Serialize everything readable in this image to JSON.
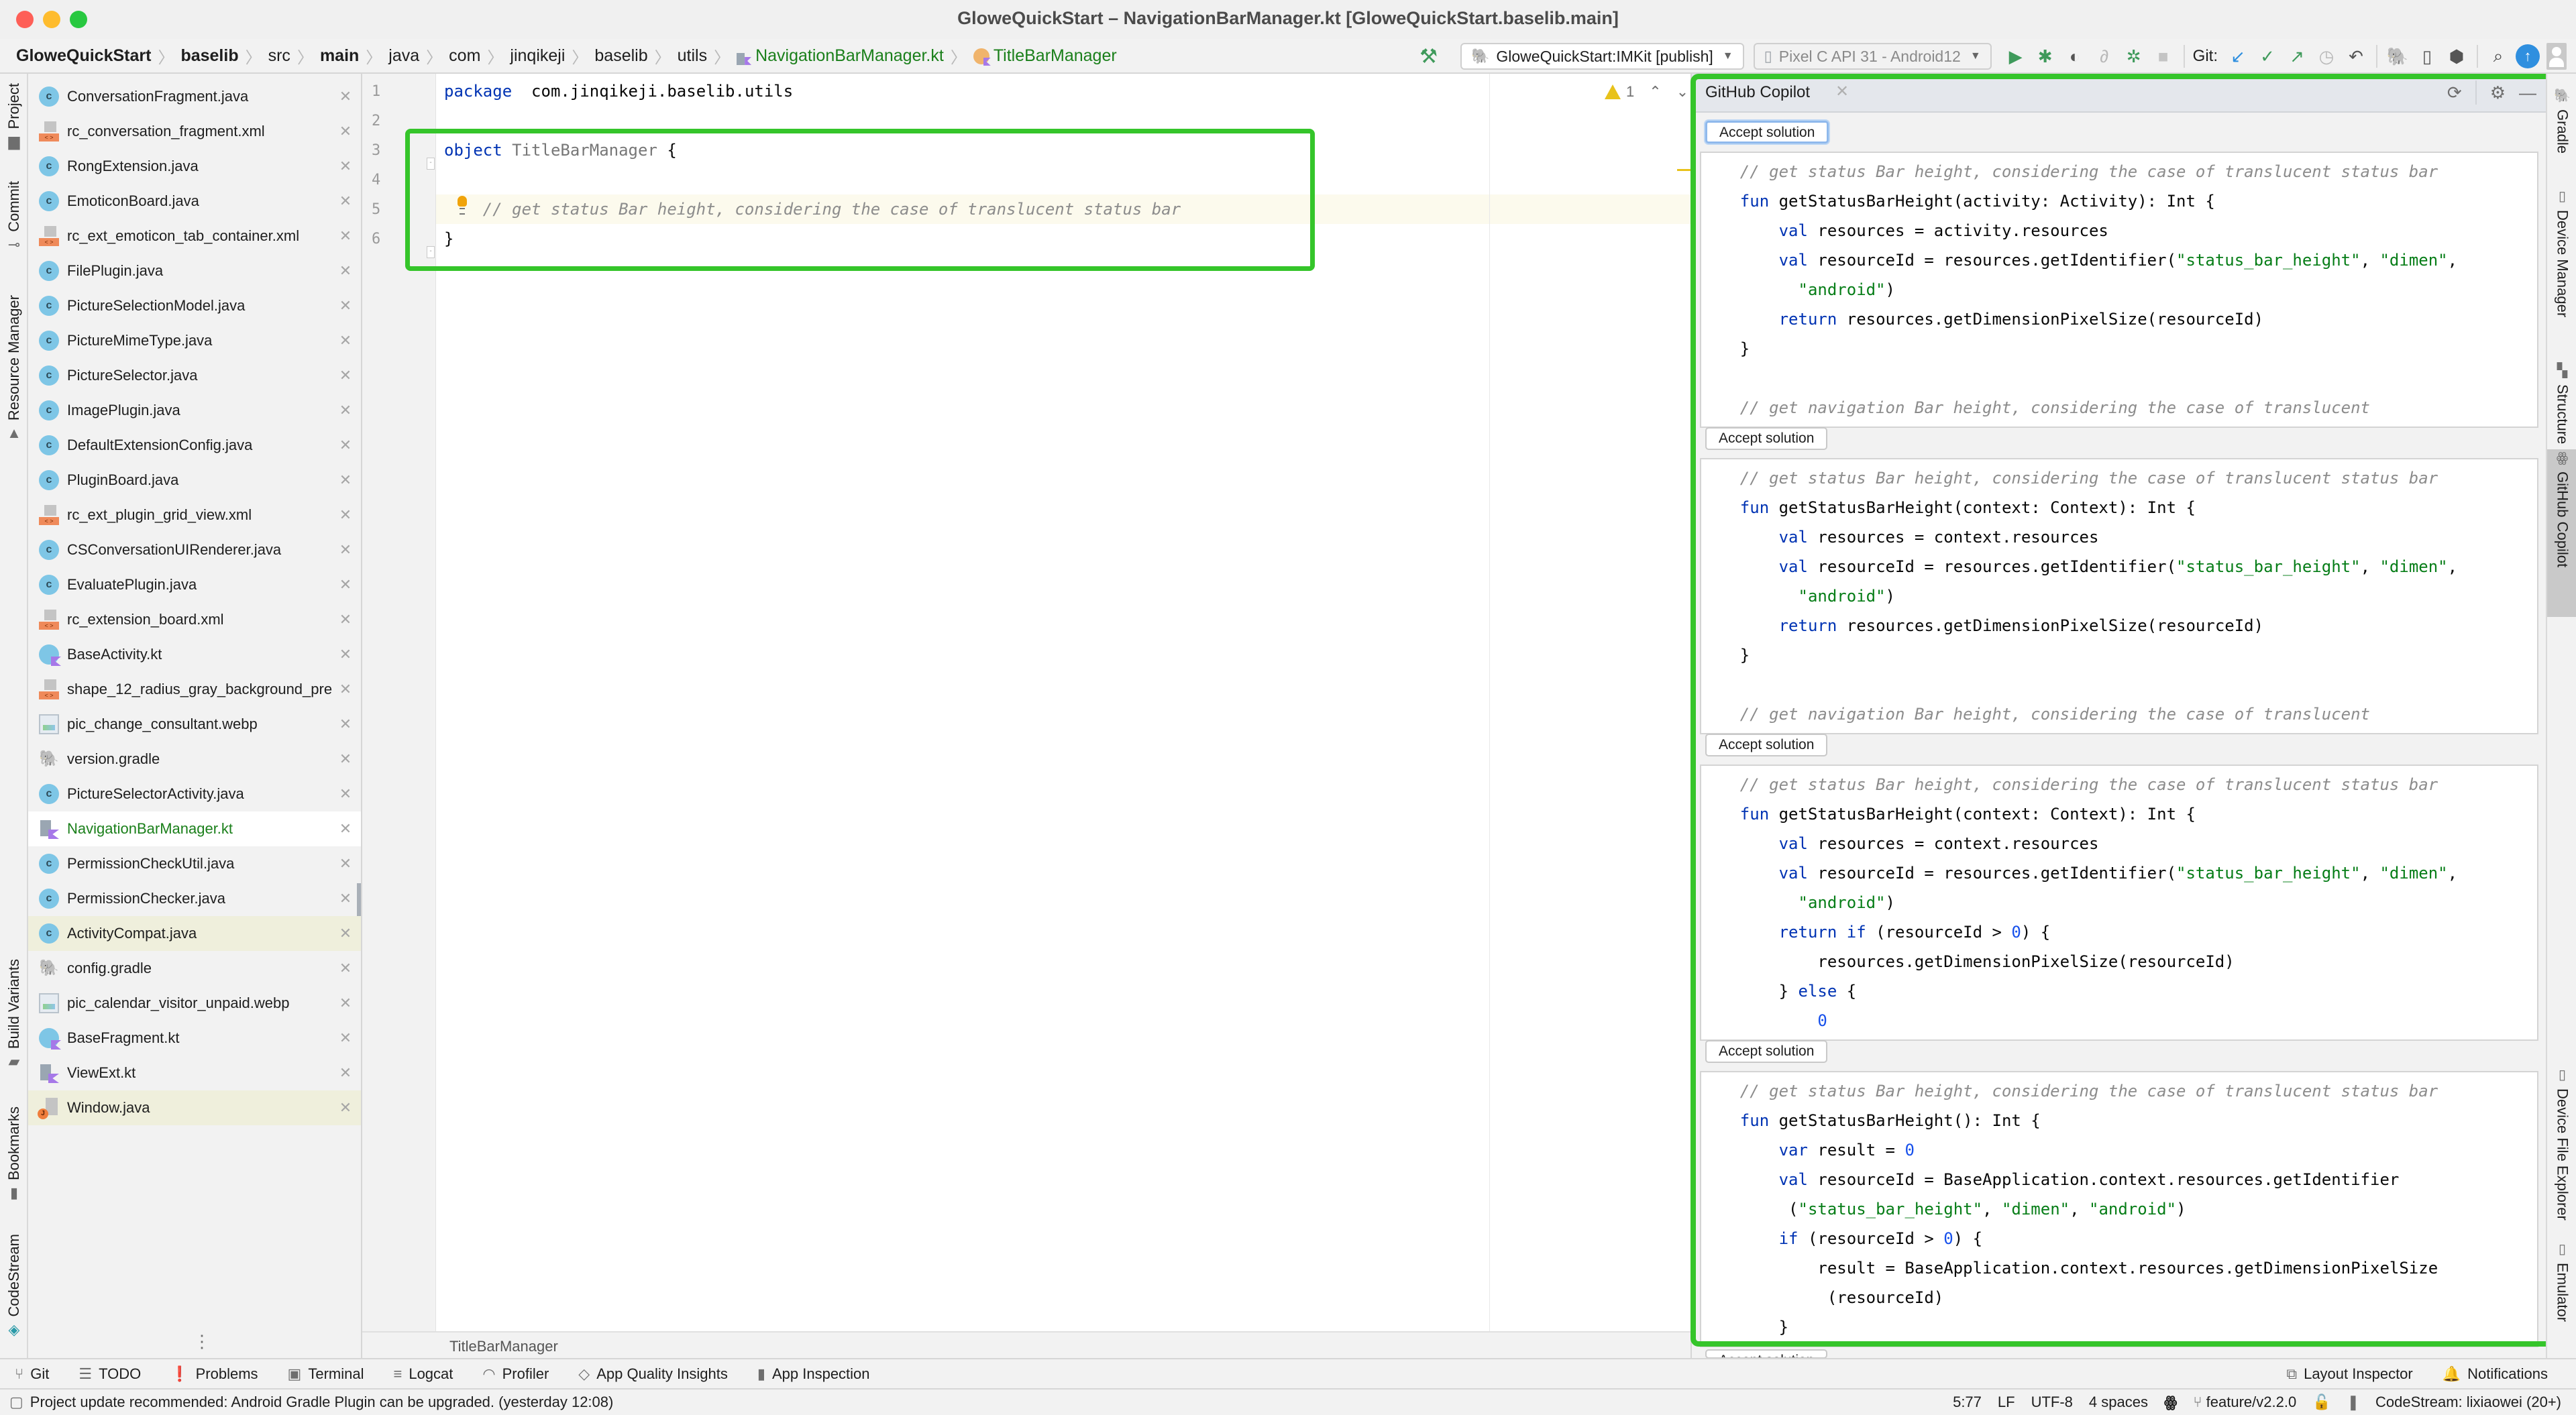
{
  "window": {
    "title": "GloweQuickStart – NavigationBarManager.kt [GloweQuickStart.baselib.main]"
  },
  "breadcrumb": [
    {
      "label": "GloweQuickStart",
      "bold": true
    },
    {
      "label": "baselib",
      "bold": true
    },
    {
      "label": "src",
      "bold": false
    },
    {
      "label": "main",
      "bold": true
    },
    {
      "label": "java",
      "bold": false
    },
    {
      "label": "com",
      "bold": false
    },
    {
      "label": "jinqikeji",
      "bold": false
    },
    {
      "label": "baselib",
      "bold": false
    },
    {
      "label": "utils",
      "bold": false
    },
    {
      "label": "NavigationBarManager.kt",
      "icon": "kotlin-file-icon"
    },
    {
      "label": "TitleBarManager",
      "icon": "kotlin-object-icon"
    }
  ],
  "toolbar": {
    "run_config": "GloweQuickStart:IMKit [publish]",
    "device": "Pixel C API 31 - Android12",
    "git_label": "Git:",
    "icons": [
      "build-hammer-icon",
      "run-icon",
      "debug-icon",
      "apply-changes-icon",
      "profile-icon",
      "attach-debugger-icon",
      "stop-icon",
      "git-update-icon",
      "git-commit-icon",
      "git-push-icon",
      "git-history-icon",
      "git-rollback-icon",
      "gradle-sync-icon",
      "device-manager-icon",
      "sdk-manager-icon",
      "search-icon",
      "update-icon",
      "avatar-icon"
    ]
  },
  "left_strip": {
    "top": [
      {
        "label": "Project",
        "icon": "folder-icon"
      },
      {
        "label": "Commit",
        "icon": "commit-icon"
      },
      {
        "label": "Resource Manager",
        "icon": "resource-manager-icon"
      }
    ],
    "bottom": [
      {
        "label": "Build Variants",
        "icon": "android-icon"
      },
      {
        "label": "Bookmarks",
        "icon": "bookmark-icon"
      },
      {
        "label": "CodeStream",
        "icon": "codestream-icon"
      }
    ]
  },
  "open_files": [
    {
      "name": "ConversationFragment.java",
      "type": "class",
      "state": ""
    },
    {
      "name": "rc_conversation_fragment.xml",
      "type": "xml",
      "state": ""
    },
    {
      "name": "RongExtension.java",
      "type": "class",
      "state": ""
    },
    {
      "name": "EmoticonBoard.java",
      "type": "class",
      "state": ""
    },
    {
      "name": "rc_ext_emoticon_tab_container.xml",
      "type": "xml",
      "state": ""
    },
    {
      "name": "FilePlugin.java",
      "type": "class",
      "state": ""
    },
    {
      "name": "PictureSelectionModel.java",
      "type": "class",
      "state": ""
    },
    {
      "name": "PictureMimeType.java",
      "type": "class",
      "state": ""
    },
    {
      "name": "PictureSelector.java",
      "type": "class",
      "state": ""
    },
    {
      "name": "ImagePlugin.java",
      "type": "class",
      "state": ""
    },
    {
      "name": "DefaultExtensionConfig.java",
      "type": "class",
      "state": ""
    },
    {
      "name": "PluginBoard.java",
      "type": "class",
      "state": ""
    },
    {
      "name": "rc_ext_plugin_grid_view.xml",
      "type": "xml",
      "state": ""
    },
    {
      "name": "CSConversationUIRenderer.java",
      "type": "class",
      "state": ""
    },
    {
      "name": "EvaluatePlugin.java",
      "type": "class",
      "state": ""
    },
    {
      "name": "rc_extension_board.xml",
      "type": "xml",
      "state": ""
    },
    {
      "name": "BaseActivity.kt",
      "type": "ktclass",
      "state": ""
    },
    {
      "name": "shape_12_radius_gray_background_pre",
      "type": "xml",
      "state": ""
    },
    {
      "name": "pic_change_consultant.webp",
      "type": "img",
      "state": ""
    },
    {
      "name": "version.gradle",
      "type": "gradle",
      "state": ""
    },
    {
      "name": "PictureSelectorActivity.java",
      "type": "class",
      "state": ""
    },
    {
      "name": "NavigationBarManager.kt",
      "type": "kt",
      "state": "active"
    },
    {
      "name": "PermissionCheckUtil.java",
      "type": "class",
      "state": ""
    },
    {
      "name": "PermissionChecker.java",
      "type": "class",
      "state": ""
    },
    {
      "name": "ActivityCompat.java",
      "type": "class",
      "state": "modified"
    },
    {
      "name": "config.gradle",
      "type": "gradle",
      "state": ""
    },
    {
      "name": "pic_calendar_visitor_unpaid.webp",
      "type": "img",
      "state": ""
    },
    {
      "name": "BaseFragment.kt",
      "type": "ktclass",
      "state": ""
    },
    {
      "name": "ViewExt.kt",
      "type": "kt",
      "state": ""
    },
    {
      "name": "Window.java",
      "type": "java",
      "state": "modified"
    }
  ],
  "editor": {
    "lines": [
      {
        "no": "1",
        "tokens": [
          [
            "kw",
            "package"
          ],
          [
            "",
            "  com.jinqikeji.baselib.utils"
          ]
        ]
      },
      {
        "no": "2",
        "tokens": []
      },
      {
        "no": "3",
        "tokens": [
          [
            "kw",
            "object"
          ],
          [
            "",
            " "
          ],
          [
            "ident-gray",
            "TitleBarManager"
          ],
          [
            "",
            " {"
          ]
        ]
      },
      {
        "no": "4",
        "tokens": []
      },
      {
        "no": "5",
        "tokens": [
          [
            "",
            " "
          ],
          [
            "cmt",
            "   // get status Bar height, considering the case of translucent status bar"
          ]
        ]
      },
      {
        "no": "6",
        "tokens": [
          [
            "",
            "}"
          ]
        ]
      }
    ],
    "current_line": 5,
    "warning_count": "1",
    "footer_breadcrumb": "TitleBarManager"
  },
  "copilot": {
    "title": "GitHub Copilot",
    "accept_label": "Accept solution",
    "solutions": [
      {
        "lines": [
          [
            [
              "cmt",
              "    // get status Bar height, considering the case of translucent status bar"
            ]
          ],
          [
            [
              "",
              "    "
            ],
            [
              "kw",
              "fun"
            ],
            [
              "",
              " getStatusBarHeight(activity: Activity): Int {"
            ]
          ],
          [
            [
              "",
              "        "
            ],
            [
              "kw",
              "val"
            ],
            [
              "",
              " resources = activity.resources"
            ]
          ],
          [
            [
              "",
              "        "
            ],
            [
              "kw",
              "val"
            ],
            [
              "",
              " resourceId = resources.getIdentifier("
            ],
            [
              "str",
              "\"status_bar_height\""
            ],
            [
              "",
              ", "
            ],
            [
              "str",
              "\"dimen\""
            ],
            [
              "",
              ","
            ]
          ],
          [
            [
              "",
              "          "
            ],
            [
              "str",
              "\"android\""
            ],
            [
              "",
              ")"
            ]
          ],
          [
            [
              "",
              "        "
            ],
            [
              "kw",
              "return"
            ],
            [
              "",
              " resources.getDimensionPixelSize(resourceId)"
            ]
          ],
          [
            [
              "",
              "    }"
            ]
          ],
          [],
          [
            [
              "cmt",
              "    // get navigation Bar height, considering the case of translucent"
            ]
          ]
        ]
      },
      {
        "lines": [
          [
            [
              "cmt",
              "    // get status Bar height, considering the case of translucent status bar"
            ]
          ],
          [
            [
              "",
              "    "
            ],
            [
              "kw",
              "fun"
            ],
            [
              "",
              " getStatusBarHeight(context: Context): Int {"
            ]
          ],
          [
            [
              "",
              "        "
            ],
            [
              "kw",
              "val"
            ],
            [
              "",
              " resources = context.resources"
            ]
          ],
          [
            [
              "",
              "        "
            ],
            [
              "kw",
              "val"
            ],
            [
              "",
              " resourceId = resources.getIdentifier("
            ],
            [
              "str",
              "\"status_bar_height\""
            ],
            [
              "",
              ", "
            ],
            [
              "str",
              "\"dimen\""
            ],
            [
              "",
              ","
            ]
          ],
          [
            [
              "",
              "          "
            ],
            [
              "str",
              "\"android\""
            ],
            [
              "",
              ")"
            ]
          ],
          [
            [
              "",
              "        "
            ],
            [
              "kw",
              "return"
            ],
            [
              "",
              " resources.getDimensionPixelSize(resourceId)"
            ]
          ],
          [
            [
              "",
              "    }"
            ]
          ],
          [],
          [
            [
              "cmt",
              "    // get navigation Bar height, considering the case of translucent"
            ]
          ]
        ]
      },
      {
        "lines": [
          [
            [
              "cmt",
              "    // get status Bar height, considering the case of translucent status bar"
            ]
          ],
          [
            [
              "",
              "    "
            ],
            [
              "kw",
              "fun"
            ],
            [
              "",
              " getStatusBarHeight(context: Context): Int {"
            ]
          ],
          [
            [
              "",
              "        "
            ],
            [
              "kw",
              "val"
            ],
            [
              "",
              " resources = context.resources"
            ]
          ],
          [
            [
              "",
              "        "
            ],
            [
              "kw",
              "val"
            ],
            [
              "",
              " resourceId = resources.getIdentifier("
            ],
            [
              "str",
              "\"status_bar_height\""
            ],
            [
              "",
              ", "
            ],
            [
              "str",
              "\"dimen\""
            ],
            [
              "",
              ","
            ]
          ],
          [
            [
              "",
              "          "
            ],
            [
              "str",
              "\"android\""
            ],
            [
              "",
              ")"
            ]
          ],
          [
            [
              "",
              "        "
            ],
            [
              "kw",
              "return"
            ],
            [
              " ",
              " "
            ],
            [
              "kw",
              "if"
            ],
            [
              "",
              " (resourceId > "
            ],
            [
              "num",
              "0"
            ],
            [
              "",
              ") {"
            ]
          ],
          [
            [
              "",
              "            resources.getDimensionPixelSize(resourceId)"
            ]
          ],
          [
            [
              "",
              "        } "
            ],
            [
              "kw",
              "else"
            ],
            [
              "",
              " {"
            ]
          ],
          [
            [
              "",
              "            "
            ],
            [
              "num",
              "0"
            ]
          ]
        ]
      },
      {
        "lines": [
          [
            [
              "cmt",
              "    // get status Bar height, considering the case of translucent status bar"
            ]
          ],
          [
            [
              "",
              "    "
            ],
            [
              "kw",
              "fun"
            ],
            [
              "",
              " getStatusBarHeight(): Int {"
            ]
          ],
          [
            [
              "",
              "        "
            ],
            [
              "kw",
              "var"
            ],
            [
              "",
              " result = "
            ],
            [
              "num",
              "0"
            ]
          ],
          [
            [
              "",
              "        "
            ],
            [
              "kw",
              "val"
            ],
            [
              "",
              " resourceId = BaseApplication.context.resources.getIdentifier"
            ]
          ],
          [
            [
              "",
              "         ("
            ],
            [
              "str",
              "\"status_bar_height\""
            ],
            [
              "",
              ", "
            ],
            [
              "str",
              "\"dimen\""
            ],
            [
              "",
              ", "
            ],
            [
              "str",
              "\"android\""
            ],
            [
              "",
              ")"
            ]
          ],
          [
            [
              "",
              "        "
            ],
            [
              "kw",
              "if"
            ],
            [
              "",
              " (resourceId > "
            ],
            [
              "num",
              "0"
            ],
            [
              "",
              ") {"
            ]
          ],
          [
            [
              "",
              "            result = BaseApplication.context.resources.getDimensionPixelSize"
            ]
          ],
          [
            [
              "",
              "             (resourceId)"
            ]
          ],
          [
            [
              "",
              "        }"
            ]
          ]
        ]
      }
    ]
  },
  "right_strip": [
    {
      "label": "Gradle",
      "icon": "gradle-icon",
      "active": false
    },
    {
      "label": "Device Manager",
      "icon": "device-manager-icon",
      "active": false
    },
    {
      "label": "Structure",
      "icon": "structure-icon",
      "active": false
    },
    {
      "label": "GitHub Copilot",
      "icon": "copilot-icon",
      "active": true
    },
    {
      "label": "Device File Explorer",
      "icon": "device-file-explorer-icon",
      "active": false
    },
    {
      "label": "Emulator",
      "icon": "emulator-icon",
      "active": false
    }
  ],
  "bottom_tools": {
    "left": [
      {
        "label": "Git",
        "icon": "git-branch-icon",
        "glyph": "⑂"
      },
      {
        "label": "TODO",
        "icon": "todo-list-icon",
        "glyph": "☰"
      },
      {
        "label": "Problems",
        "icon": "problems-icon",
        "glyph": "❗"
      },
      {
        "label": "Terminal",
        "icon": "terminal-icon",
        "glyph": "▣"
      },
      {
        "label": "Logcat",
        "icon": "logcat-icon",
        "glyph": "≡"
      },
      {
        "label": "Profiler",
        "icon": "profiler-icon",
        "glyph": "◠"
      },
      {
        "label": "App Quality Insights",
        "icon": "app-quality-icon",
        "glyph": "◇"
      },
      {
        "label": "App Inspection",
        "icon": "app-inspection-icon",
        "glyph": "▮"
      }
    ],
    "right": [
      {
        "label": "Layout Inspector",
        "icon": "layout-inspector-icon",
        "glyph": "⧉"
      },
      {
        "label": "Notifications",
        "icon": "notifications-bell-icon",
        "glyph": "🔔"
      }
    ]
  },
  "status": {
    "message": "Project update recommended: Android Gradle Plugin can be upgraded. (yesterday 12:08)",
    "position": "5:77",
    "line_separator": "LF",
    "encoding": "UTF-8",
    "indent": "4 spaces",
    "branch": "feature/v2.2.0",
    "codestream": "CodeStream:  lixiaowei (20+)"
  }
}
